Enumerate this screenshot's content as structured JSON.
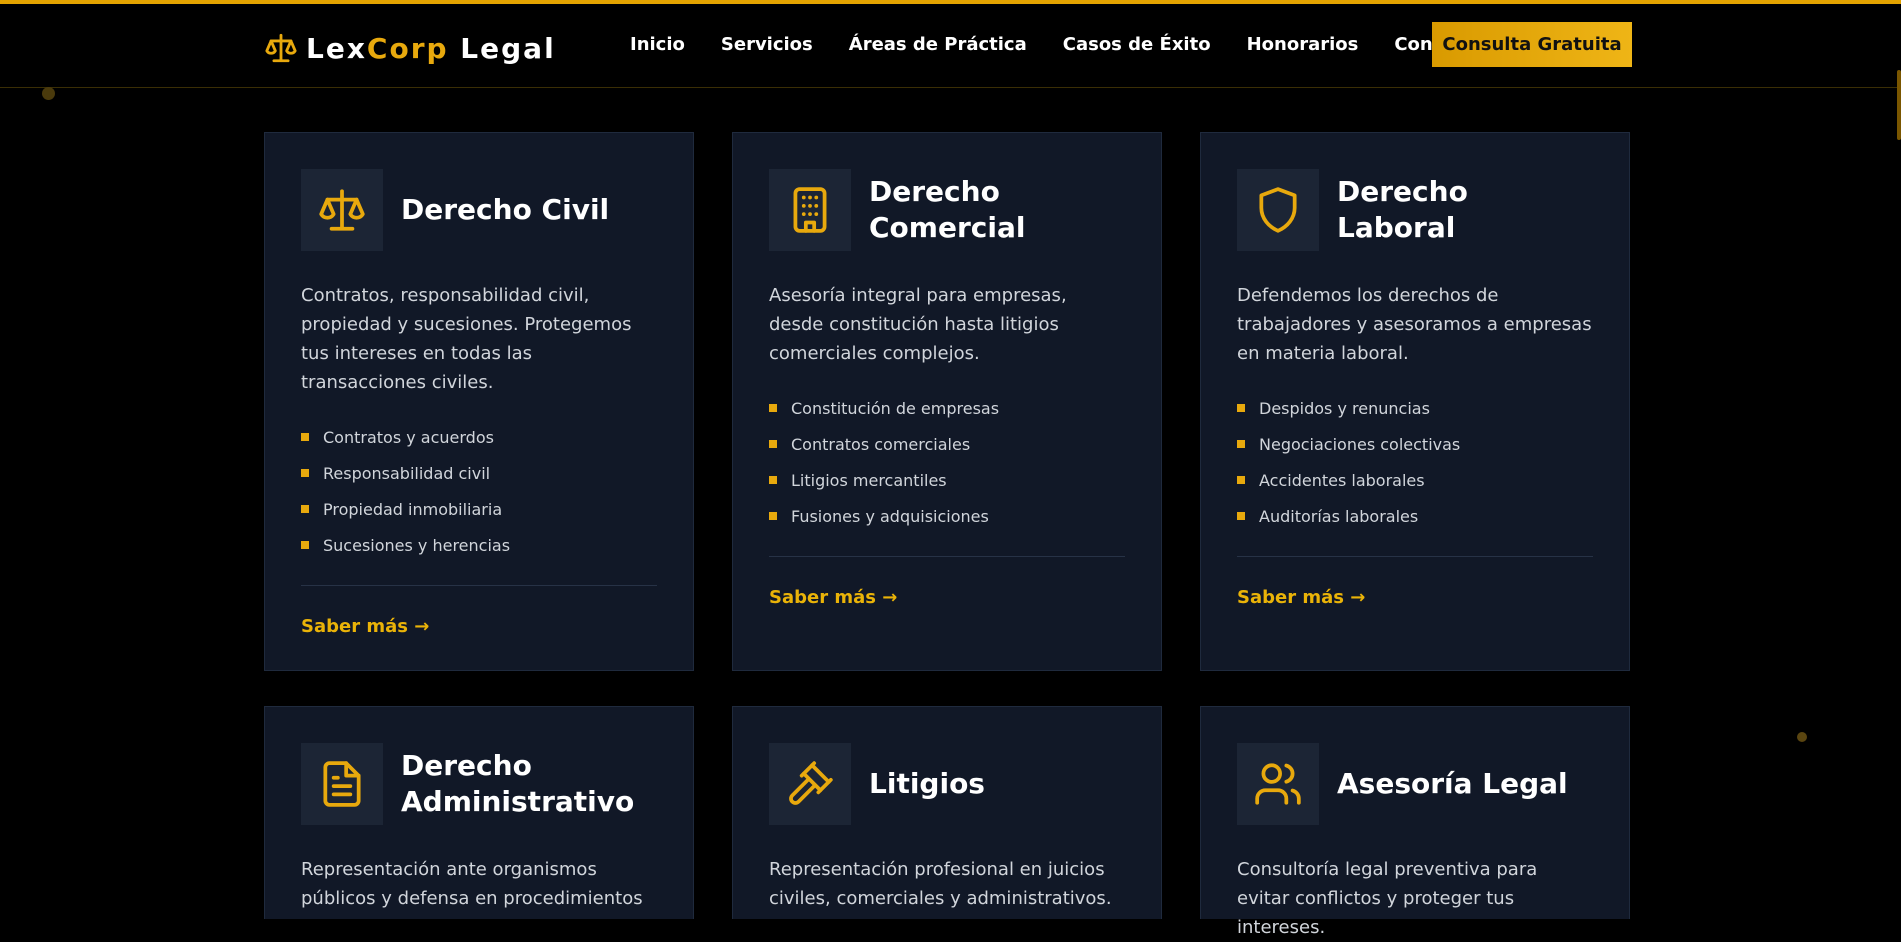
{
  "header": {
    "logo": {
      "part1": "Lex",
      "part2": "Corp",
      "part3": "Legal",
      "icon": "scales-icon"
    },
    "nav": [
      {
        "label": "Inicio"
      },
      {
        "label": "Servicios"
      },
      {
        "label": "Áreas de Práctica"
      },
      {
        "label": "Casos de Éxito"
      },
      {
        "label": "Honorarios"
      },
      {
        "label": "Contacto"
      }
    ],
    "cta_label": "Consulta Gratuita"
  },
  "colors": {
    "background": "#000000",
    "card": "#111827",
    "accent": "#e8a90d",
    "text": "#d1d5db"
  },
  "cards": [
    {
      "icon": "scales-icon",
      "title": "Derecho Civil",
      "description": "Contratos, responsabilidad civil, propiedad y sucesiones. Protegemos tus intereses en todas las transacciones civiles.",
      "items": [
        "Contratos y acuerdos",
        "Responsabilidad civil",
        "Propiedad inmobiliaria",
        "Sucesiones y herencias"
      ],
      "link": "Saber más →"
    },
    {
      "icon": "building-icon",
      "title": "Derecho Comercial",
      "description": "Asesoría integral para empresas, desde constitución hasta litigios comerciales complejos.",
      "items": [
        "Constitución de empresas",
        "Contratos comerciales",
        "Litigios mercantiles",
        "Fusiones y adquisiciones"
      ],
      "link": "Saber más →"
    },
    {
      "icon": "shield-icon",
      "title": "Derecho Laboral",
      "description": "Defendemos los derechos de trabajadores y asesoramos a empresas en materia laboral.",
      "items": [
        "Despidos y renuncias",
        "Negociaciones colectivas",
        "Accidentes laborales",
        "Auditorías laborales"
      ],
      "link": "Saber más →"
    },
    {
      "icon": "document-icon",
      "title": "Derecho Administrativo",
      "description": "Representación ante organismos públicos y defensa en procedimientos"
    },
    {
      "icon": "gavel-icon",
      "title": "Litigios",
      "description": "Representación profesional en juicios civiles, comerciales y administrativos."
    },
    {
      "icon": "users-icon",
      "title": "Asesoría Legal",
      "description": "Consultoría legal preventiva para evitar conflictos y proteger tus intereses."
    }
  ]
}
